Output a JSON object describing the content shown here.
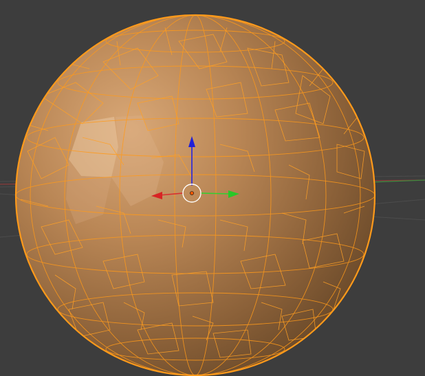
{
  "viewport": {
    "background": "#3d3d3d",
    "mode": "edit-mode",
    "object": "sphere-mesh",
    "selection": "all"
  },
  "colors": {
    "selected_wire": "#ff9a1a",
    "selected_vertex": "#ffb040",
    "face_light": "#d8a070",
    "face_dark": "#5e4024",
    "grid_line": "#4a4a4a",
    "x_axis": "#c83232",
    "y_axis": "#32c832",
    "z_axis": "#2020d0"
  },
  "gizmo": {
    "type": "translate",
    "axes": [
      "x",
      "y",
      "z"
    ],
    "icons": [
      "x-arrow-icon",
      "y-arrow-icon",
      "z-arrow-icon",
      "pivot-circle-icon"
    ]
  }
}
